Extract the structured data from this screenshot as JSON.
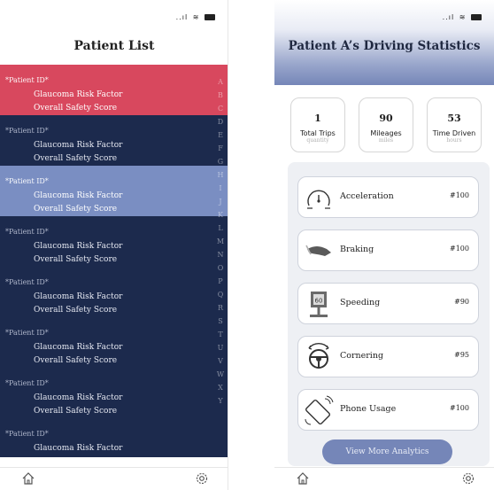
{
  "status_bar": {
    "signal": "..ıl",
    "wifi": "≋",
    "battery": "battery"
  },
  "left": {
    "title": "Patient List",
    "rows": [
      {
        "id": "*Patient ID*",
        "f1": "Glaucoma Risk Factor",
        "f2": "Overall Safety Score"
      },
      {
        "id": "*Patient ID*",
        "f1": "Glaucoma Risk Factor",
        "f2": "Overall Safety Score"
      },
      {
        "id": "*Patient ID*",
        "f1": "Glaucoma Risk Factor",
        "f2": "Overall Safety Score"
      },
      {
        "id": "*Patient ID*",
        "f1": "Glaucoma Risk Factor",
        "f2": "Overall Safety Score"
      },
      {
        "id": "*Patient ID*",
        "f1": "Glaucoma Risk Factor",
        "f2": "Overall Safety Score"
      },
      {
        "id": "*Patient ID*",
        "f1": "Glaucoma Risk Factor",
        "f2": "Overall Safety Score"
      },
      {
        "id": "*Patient ID*",
        "f1": "Glaucoma Risk Factor",
        "f2": "Overall Safety Score"
      },
      {
        "id": "*Patient ID*",
        "f1": "Glaucoma Risk Factor",
        "f2": ""
      }
    ],
    "alphabet": [
      "A",
      "B",
      "C",
      "D",
      "E",
      "F",
      "G",
      "H",
      "I",
      "J",
      "K",
      "L",
      "M",
      "N",
      "O",
      "P",
      "Q",
      "R",
      "S",
      "T",
      "U",
      "V",
      "W",
      "X",
      "Y"
    ],
    "colors": {
      "highlight_red": "#d8485e",
      "navy": "#1c2a4d",
      "selected_blue": "#7a8ec2"
    }
  },
  "right": {
    "title": "Patient A’s Driving Statistics",
    "stats": [
      {
        "value": "1",
        "label": "Total Trips",
        "unit": "quantity"
      },
      {
        "value": "90",
        "label": "Mileages",
        "unit": "miles"
      },
      {
        "value": "53",
        "label": "Time Driven",
        "unit": "hours"
      }
    ],
    "metrics": [
      {
        "label": "Acceleration",
        "value": "#100",
        "icon": "speedometer-icon"
      },
      {
        "label": "Braking",
        "value": "#100",
        "icon": "brake-pedal-icon"
      },
      {
        "label": "Speeding",
        "value": "#90",
        "icon": "speed-limit-sign-icon"
      },
      {
        "label": "Cornering",
        "value": "#95",
        "icon": "steering-wheel-icon"
      },
      {
        "label": "Phone Usage",
        "value": "#100",
        "icon": "phone-icon"
      }
    ],
    "cta": "View More Analytics",
    "speed_sign": "60",
    "colors": {
      "accent": "#7586b8",
      "panel_bg": "#eef0f4"
    }
  },
  "nav": {
    "home_icon": "home-icon",
    "settings_icon": "gear-icon"
  }
}
